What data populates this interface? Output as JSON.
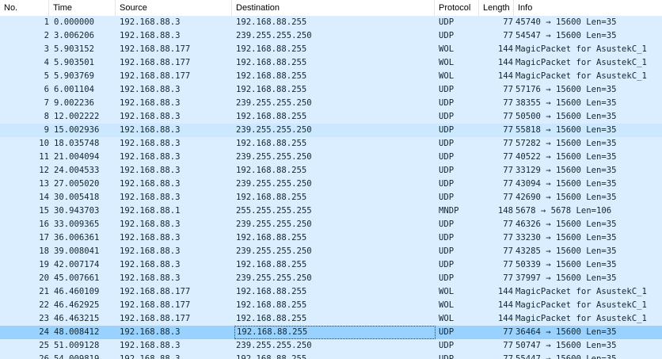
{
  "columns": {
    "no": "No.",
    "time": "Time",
    "source": "Source",
    "destination": "Destination",
    "protocol": "Protocol",
    "length": "Length",
    "info": "Info"
  },
  "colors": {
    "udp_row": "#daeeff",
    "wol_row": "#daeeff",
    "mndp_row": "#daeeff",
    "hover_row": "#cce8ff",
    "selected_row": "#99d1ff",
    "text": "#12272e"
  },
  "packets": [
    {
      "no": "1",
      "time": "0.000000",
      "source": "192.168.88.3",
      "destination": "192.168.88.255",
      "protocol": "UDP",
      "length": "77",
      "info": "45740 → 15600 Len=35"
    },
    {
      "no": "2",
      "time": "3.006206",
      "source": "192.168.88.3",
      "destination": "239.255.255.250",
      "protocol": "UDP",
      "length": "77",
      "info": "54547 → 15600 Len=35"
    },
    {
      "no": "3",
      "time": "5.903152",
      "source": "192.168.88.177",
      "destination": "192.168.88.255",
      "protocol": "WOL",
      "length": "144",
      "info": "MagicPacket for AsustekC_1"
    },
    {
      "no": "4",
      "time": "5.903501",
      "source": "192.168.88.177",
      "destination": "192.168.88.255",
      "protocol": "WOL",
      "length": "144",
      "info": "MagicPacket for AsustekC_1"
    },
    {
      "no": "5",
      "time": "5.903769",
      "source": "192.168.88.177",
      "destination": "192.168.88.255",
      "protocol": "WOL",
      "length": "144",
      "info": "MagicPacket for AsustekC_1"
    },
    {
      "no": "6",
      "time": "6.001104",
      "source": "192.168.88.3",
      "destination": "192.168.88.255",
      "protocol": "UDP",
      "length": "77",
      "info": "57176 → 15600 Len=35"
    },
    {
      "no": "7",
      "time": "9.002236",
      "source": "192.168.88.3",
      "destination": "239.255.255.250",
      "protocol": "UDP",
      "length": "77",
      "info": "38355 → 15600 Len=35"
    },
    {
      "no": "8",
      "time": "12.002222",
      "source": "192.168.88.3",
      "destination": "192.168.88.255",
      "protocol": "UDP",
      "length": "77",
      "info": "50500 → 15600 Len=35"
    },
    {
      "no": "9",
      "time": "15.002936",
      "source": "192.168.88.3",
      "destination": "239.255.255.250",
      "protocol": "UDP",
      "length": "77",
      "info": "55818 → 15600 Len=35",
      "state": "hover"
    },
    {
      "no": "10",
      "time": "18.035748",
      "source": "192.168.88.3",
      "destination": "192.168.88.255",
      "protocol": "UDP",
      "length": "77",
      "info": "57282 → 15600 Len=35"
    },
    {
      "no": "11",
      "time": "21.004094",
      "source": "192.168.88.3",
      "destination": "239.255.255.250",
      "protocol": "UDP",
      "length": "77",
      "info": "40522 → 15600 Len=35"
    },
    {
      "no": "12",
      "time": "24.004533",
      "source": "192.168.88.3",
      "destination": "192.168.88.255",
      "protocol": "UDP",
      "length": "77",
      "info": "33129 → 15600 Len=35"
    },
    {
      "no": "13",
      "time": "27.005020",
      "source": "192.168.88.3",
      "destination": "239.255.255.250",
      "protocol": "UDP",
      "length": "77",
      "info": "43094 → 15600 Len=35"
    },
    {
      "no": "14",
      "time": "30.005418",
      "source": "192.168.88.3",
      "destination": "192.168.88.255",
      "protocol": "UDP",
      "length": "77",
      "info": "42690 → 15600 Len=35"
    },
    {
      "no": "15",
      "time": "30.943703",
      "source": "192.168.88.1",
      "destination": "255.255.255.255",
      "protocol": "MNDP",
      "length": "148",
      "info": "5678 → 5678 Len=106"
    },
    {
      "no": "16",
      "time": "33.009365",
      "source": "192.168.88.3",
      "destination": "239.255.255.250",
      "protocol": "UDP",
      "length": "77",
      "info": "46326 → 15600 Len=35"
    },
    {
      "no": "17",
      "time": "36.006361",
      "source": "192.168.88.3",
      "destination": "192.168.88.255",
      "protocol": "UDP",
      "length": "77",
      "info": "33230 → 15600 Len=35"
    },
    {
      "no": "18",
      "time": "39.008041",
      "source": "192.168.88.3",
      "destination": "239.255.255.250",
      "protocol": "UDP",
      "length": "77",
      "info": "43285 → 15600 Len=35"
    },
    {
      "no": "19",
      "time": "42.007174",
      "source": "192.168.88.3",
      "destination": "192.168.88.255",
      "protocol": "UDP",
      "length": "77",
      "info": "50339 → 15600 Len=35"
    },
    {
      "no": "20",
      "time": "45.007661",
      "source": "192.168.88.3",
      "destination": "239.255.255.250",
      "protocol": "UDP",
      "length": "77",
      "info": "37997 → 15600 Len=35"
    },
    {
      "no": "21",
      "time": "46.460109",
      "source": "192.168.88.177",
      "destination": "192.168.88.255",
      "protocol": "WOL",
      "length": "144",
      "info": "MagicPacket for AsustekC_1"
    },
    {
      "no": "22",
      "time": "46.462925",
      "source": "192.168.88.177",
      "destination": "192.168.88.255",
      "protocol": "WOL",
      "length": "144",
      "info": "MagicPacket for AsustekC_1"
    },
    {
      "no": "23",
      "time": "46.463215",
      "source": "192.168.88.177",
      "destination": "192.168.88.255",
      "protocol": "WOL",
      "length": "144",
      "info": "MagicPacket for AsustekC_1"
    },
    {
      "no": "24",
      "time": "48.008412",
      "source": "192.168.88.3",
      "destination": "192.168.88.255",
      "protocol": "UDP",
      "length": "77",
      "info": "36464 → 15600 Len=35",
      "state": "selected"
    },
    {
      "no": "25",
      "time": "51.009128",
      "source": "192.168.88.3",
      "destination": "239.255.255.250",
      "protocol": "UDP",
      "length": "77",
      "info": "50747 → 15600 Len=35"
    },
    {
      "no": "26",
      "time": "54.009819",
      "source": "192.168.88.3",
      "destination": "192.168.88.255",
      "protocol": "UDP",
      "length": "77",
      "info": "55447 → 15600 Len=35"
    }
  ]
}
